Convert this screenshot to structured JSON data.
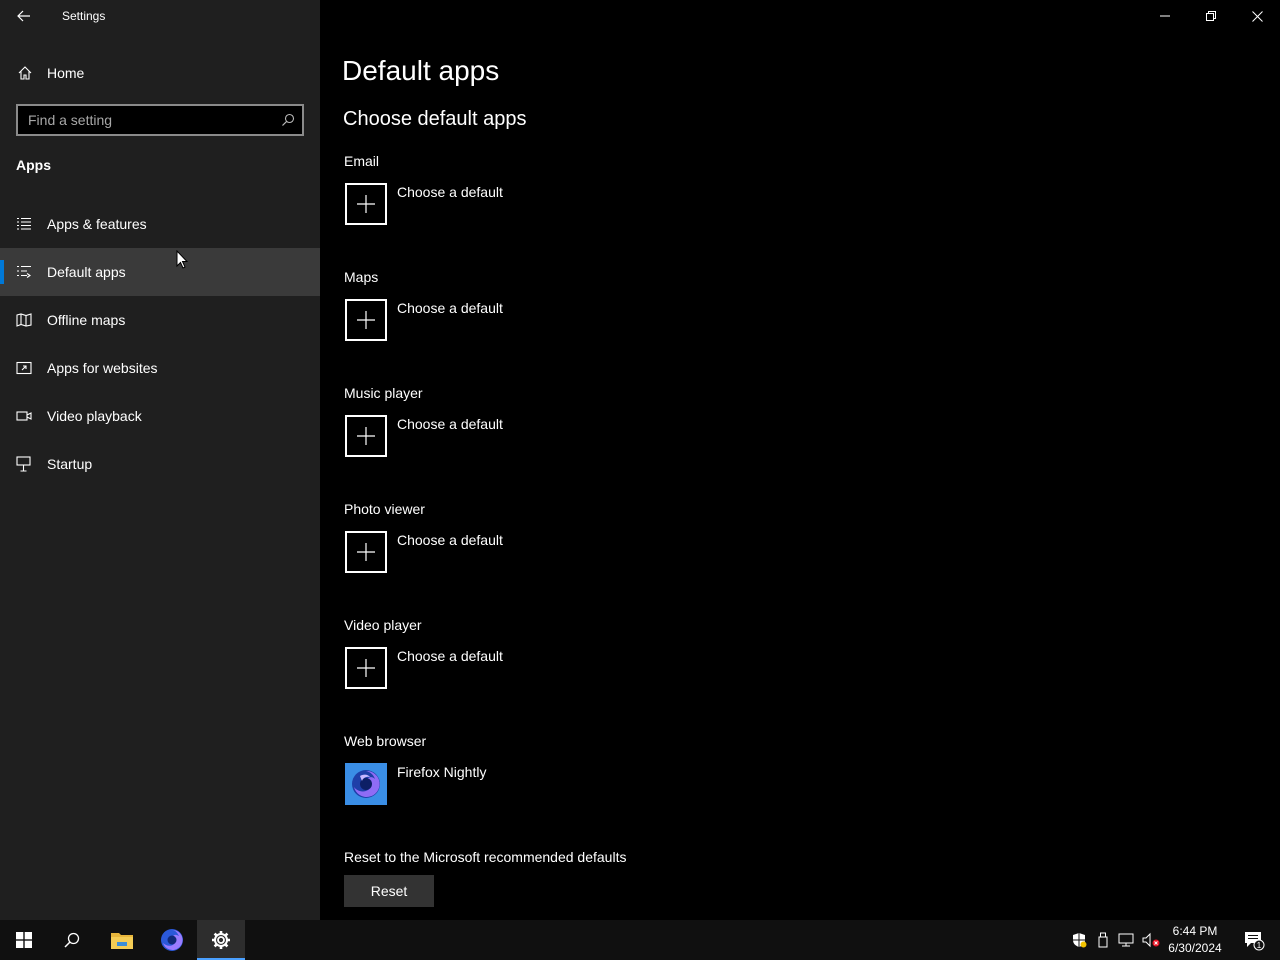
{
  "window": {
    "title": "Settings",
    "controls": [
      "minimize-icon",
      "restore-icon",
      "close-icon"
    ]
  },
  "sidebar": {
    "home_label": "Home",
    "search_placeholder": "Find a setting",
    "section_title": "Apps",
    "items": [
      {
        "label": "Apps & features",
        "icon": "apps-features-icon",
        "selected": false
      },
      {
        "label": "Default apps",
        "icon": "default-apps-icon",
        "selected": true
      },
      {
        "label": "Offline maps",
        "icon": "offline-maps-icon",
        "selected": false
      },
      {
        "label": "Apps for websites",
        "icon": "apps-for-websites-icon",
        "selected": false
      },
      {
        "label": "Video playback",
        "icon": "video-playback-icon",
        "selected": false
      },
      {
        "label": "Startup",
        "icon": "startup-icon",
        "selected": false
      }
    ]
  },
  "main": {
    "page_title": "Default apps",
    "subtitle": "Choose default apps",
    "categories": [
      {
        "label": "Email",
        "app": "Choose a default"
      },
      {
        "label": "Maps",
        "app": "Choose a default"
      },
      {
        "label": "Music player",
        "app": "Choose a default"
      },
      {
        "label": "Photo viewer",
        "app": "Choose a default"
      },
      {
        "label": "Video player",
        "app": "Choose a default"
      },
      {
        "label": "Web browser",
        "app": "Firefox Nightly"
      }
    ],
    "reset_label": "Reset to the Microsoft recommended defaults",
    "reset_button": "Reset"
  },
  "taskbar": {
    "apps": [
      "start-icon",
      "search-icon",
      "file-explorer-icon",
      "firefox-nightly-icon",
      "settings-icon"
    ],
    "active_app": "settings-icon",
    "tray": [
      "security-icon",
      "usb-icon",
      "network-icon",
      "volume-muted-icon"
    ],
    "time": "6:44 PM",
    "date": "6/30/2024",
    "notification_count": "1"
  },
  "colors": {
    "accent": "#0078d7",
    "sidebar_bg": "#1f1f1f",
    "content_bg": "#000000",
    "selected_bg": "#3a3a3a"
  }
}
